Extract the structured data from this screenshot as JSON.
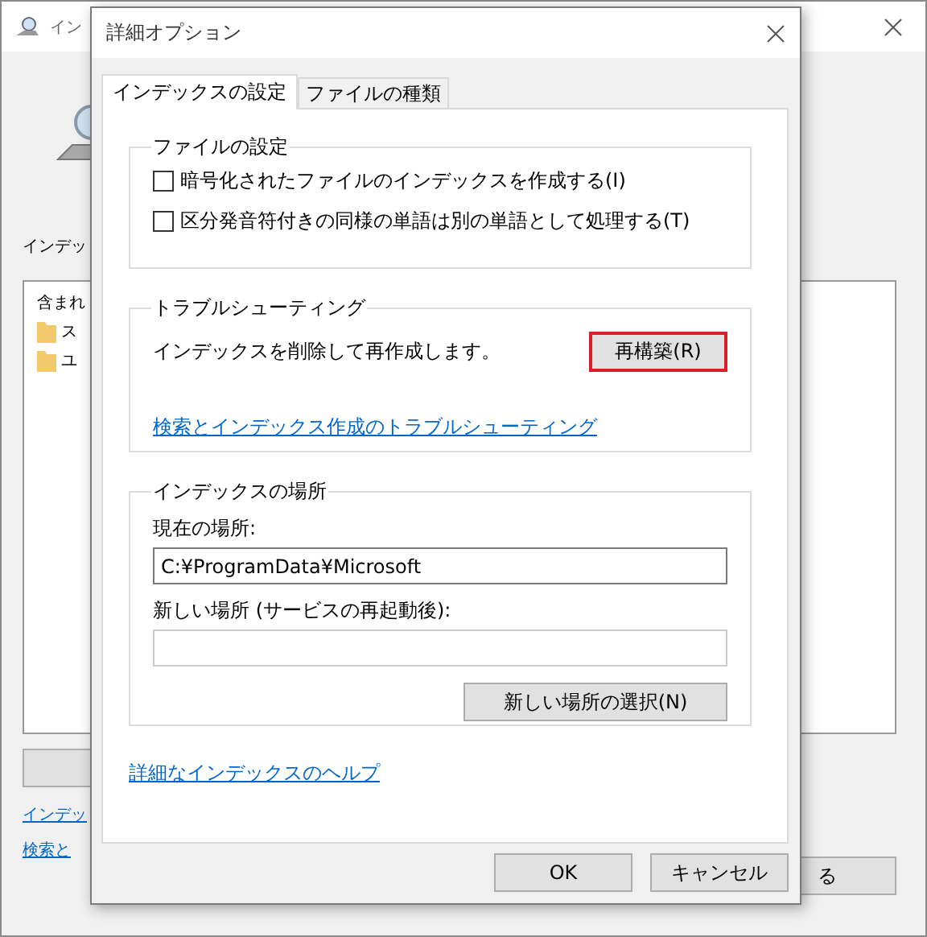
{
  "background_window": {
    "title": "イン",
    "heading": "インデッ",
    "list_header": "含まれ",
    "folders": [
      "ス",
      "ユ"
    ],
    "links": [
      "インデッ",
      "検索と"
    ],
    "button": "る"
  },
  "dialog": {
    "title": "詳細オプション",
    "tabs": [
      {
        "label": "インデックスの設定",
        "selected": true
      },
      {
        "label": "ファイルの種類",
        "selected": false
      }
    ],
    "file_settings": {
      "title": "ファイルの設定",
      "options": [
        {
          "label": "暗号化されたファイルのインデックスを作成する(I)",
          "checked": false
        },
        {
          "label": "区分発音符付きの同様の単語は別の単語として処理する(T)",
          "checked": false
        }
      ]
    },
    "troubleshooting": {
      "title": "トラブルシューティング",
      "text": "インデックスを削除して再作成します。",
      "button": {
        "label": "再構築(R)",
        "highlighted": true
      },
      "link": "検索とインデックス作成のトラブルシューティング"
    },
    "location": {
      "title": "インデックスの場所",
      "current_label": "現在の場所:",
      "current_value": "C:¥ProgramData¥Microsoft",
      "new_label": "新しい場所 (サービスの再起動後):",
      "select_button": "新しい場所の選択(N)"
    },
    "help_link": "詳細なインデックスのヘルプ",
    "buttons": [
      "OK",
      "キャンセル"
    ]
  }
}
